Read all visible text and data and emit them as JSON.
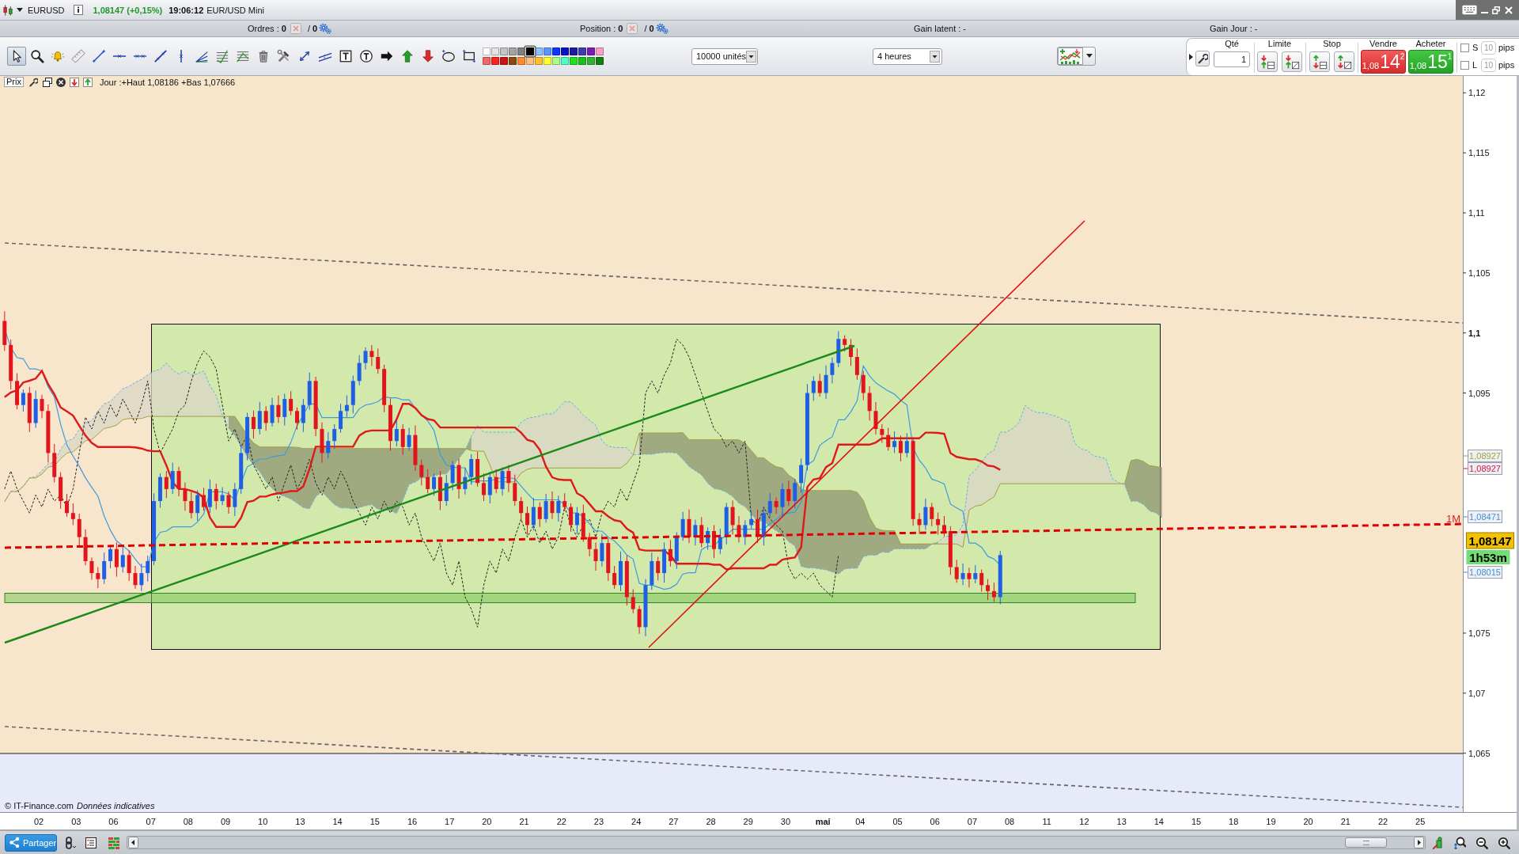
{
  "title_bar": {
    "symbol": "EURUSD",
    "quote": "1,08147 (+0,15%)",
    "time": "19:06:12",
    "instrument": "EUR/USD Mini"
  },
  "info_bar": {
    "orders": "Ordres : **0**",
    "orders_total": "/ **0**",
    "position": "Position : **0**",
    "position_total": "/ **0**",
    "unrealized_gain": "Gain latent : -",
    "daily_gain": "Gain Jour : -"
  },
  "toolbar": {
    "tools": [
      {
        "selected": true
      },
      {
        "selected": false
      },
      {
        "selected": false
      },
      {
        "selected": false
      },
      {
        "selected": false
      },
      {
        "selected": false
      },
      {
        "selected": false
      },
      {
        "selected": false
      },
      {
        "selected": false
      },
      {
        "selected": false
      },
      {
        "selected": false
      },
      {
        "selected": false
      },
      {
        "selected": false
      },
      {
        "selected": false
      },
      {
        "selected": false
      },
      {
        "selected": false
      },
      {
        "selected": false
      },
      {
        "selected": false
      },
      {
        "selected": false
      },
      {
        "selected": false
      },
      {
        "selected": false
      },
      {
        "selected": false
      },
      {
        "selected": false
      }
    ],
    "palette": [
      {
        "color": "#ffffff",
        "selected": false
      },
      {
        "color": "#e4e4e4",
        "selected": false
      },
      {
        "color": "#c4c4c4",
        "selected": false
      },
      {
        "color": "#a4a4a4",
        "selected": false
      },
      {
        "color": "#808080",
        "selected": false
      },
      {
        "color": "#000000",
        "selected": true
      },
      {
        "color": "#8cc0ff",
        "selected": false
      },
      {
        "color": "#5a96ff",
        "selected": false
      },
      {
        "color": "#1034ff",
        "selected": false
      },
      {
        "color": "#0a10c8",
        "selected": false
      },
      {
        "color": "#1c1c9c",
        "selected": false
      },
      {
        "color": "#3c3cb4",
        "selected": false
      },
      {
        "color": "#7a1cb4",
        "selected": false
      },
      {
        "color": "#ff9cc8",
        "selected": false
      },
      {
        "color": "#ec6a6a",
        "selected": false
      },
      {
        "color": "#ff2020",
        "selected": false
      },
      {
        "color": "#c81414",
        "selected": false
      },
      {
        "color": "#8a4a10",
        "selected": false
      },
      {
        "color": "#ff8a2a",
        "selected": false
      },
      {
        "color": "#ffbc7a",
        "selected": false
      },
      {
        "color": "#ffc02a",
        "selected": false
      },
      {
        "color": "#ffff30",
        "selected": false
      },
      {
        "color": "#a8ff8a",
        "selected": false
      },
      {
        "color": "#4affc8",
        "selected": false
      },
      {
        "color": "#20e020",
        "selected": false
      },
      {
        "color": "#18c018",
        "selected": false
      },
      {
        "color": "#38b038",
        "selected": false
      },
      {
        "color": "#108010",
        "selected": false
      }
    ],
    "quantity_dropdown": {
      "value": "10000 unités"
    },
    "timeframe_dropdown": {
      "value": "4 heures"
    }
  },
  "order_panel": {
    "quantity_label": "Qté",
    "quantity": "1",
    "limit_label": "Limite",
    "stop_label": "Stop",
    "sell": {
      "label": "Vendre",
      "price_prefix": "1,08",
      "price_pips": "14",
      "price_fraction": "2"
    },
    "buy": {
      "label": "Acheter",
      "price_prefix": "1,08",
      "price_pips": "15",
      "price_fraction": "1"
    },
    "distance_options": [
      {
        "label": "S",
        "checked": false,
        "value": "10",
        "unit": "pips",
        "disabled": true
      },
      {
        "label": "L",
        "checked": false,
        "value": "10",
        "unit": "pips",
        "disabled": true
      }
    ]
  },
  "chart": {
    "legend": {
      "label": "Prix",
      "text": "Jour :+Haut 1,08186 +Bas 1,07666"
    },
    "price_axis": [
      {
        "label": "1,12",
        "kind": "minor"
      },
      {
        "label": "1,115",
        "kind": "minor"
      },
      {
        "label": "1,11",
        "kind": "minor"
      },
      {
        "label": "1,105",
        "kind": "minor"
      },
      {
        "label": "1,1",
        "kind": "major"
      },
      {
        "label": "1,095",
        "kind": "minor"
      },
      {
        "label": "1,075",
        "kind": "minor"
      },
      {
        "label": "1,07",
        "kind": "minor"
      },
      {
        "label": "1,065",
        "kind": "minor"
      }
    ],
    "time_axis": [
      {
        "label": "02",
        "kind": "day"
      },
      {
        "label": "03",
        "kind": "day"
      },
      {
        "label": "06",
        "kind": "day"
      },
      {
        "label": "07",
        "kind": "day"
      },
      {
        "label": "08",
        "kind": "day"
      },
      {
        "label": "09",
        "kind": "day"
      },
      {
        "label": "10",
        "kind": "day"
      },
      {
        "label": "13",
        "kind": "day"
      },
      {
        "label": "14",
        "kind": "day"
      },
      {
        "label": "15",
        "kind": "day"
      },
      {
        "label": "16",
        "kind": "day"
      },
      {
        "label": "17",
        "kind": "day"
      },
      {
        "label": "20",
        "kind": "day"
      },
      {
        "label": "21",
        "kind": "day"
      },
      {
        "label": "22",
        "kind": "day"
      },
      {
        "label": "23",
        "kind": "day"
      },
      {
        "label": "24",
        "kind": "day"
      },
      {
        "label": "27",
        "kind": "day"
      },
      {
        "label": "28",
        "kind": "day"
      },
      {
        "label": "29",
        "kind": "day"
      },
      {
        "label": "30",
        "kind": "day"
      },
      {
        "label": "mai",
        "kind": "month"
      },
      {
        "label": "04",
        "kind": "day"
      },
      {
        "label": "05",
        "kind": "day"
      },
      {
        "label": "06",
        "kind": "day"
      },
      {
        "label": "07",
        "kind": "day"
      },
      {
        "label": "08",
        "kind": "day"
      },
      {
        "label": "11",
        "kind": "day"
      },
      {
        "label": "12",
        "kind": "day"
      },
      {
        "label": "13",
        "kind": "day"
      },
      {
        "label": "14",
        "kind": "day"
      },
      {
        "label": "15",
        "kind": "day"
      },
      {
        "label": "18",
        "kind": "day"
      },
      {
        "label": "19",
        "kind": "day"
      },
      {
        "label": "20",
        "kind": "day"
      },
      {
        "label": "21",
        "kind": "day"
      },
      {
        "label": "22",
        "kind": "day"
      },
      {
        "label": "25",
        "kind": "day"
      }
    ],
    "price_tags": [
      {
        "kind": "line",
        "text": "1,08927",
        "color": "#a3a33a"
      },
      {
        "kind": "line",
        "text": "1,08927",
        "color": "#d2143c"
      },
      {
        "kind": "line",
        "text": "1,08471",
        "color": "#3d8fe0"
      },
      {
        "kind": "price",
        "text": "1,08147",
        "color": "#f2c200"
      },
      {
        "kind": "timer",
        "text": "1h53m",
        "color": "#74dc74"
      },
      {
        "kind": "line",
        "text": "1,08015",
        "color": "#3d8fe0"
      }
    ],
    "level_label": "1M",
    "copyright": "© IT-Finance.com",
    "disclaimer": "Données indicatives"
  },
  "bottom_bar": {
    "share_label": "Partager"
  }
}
